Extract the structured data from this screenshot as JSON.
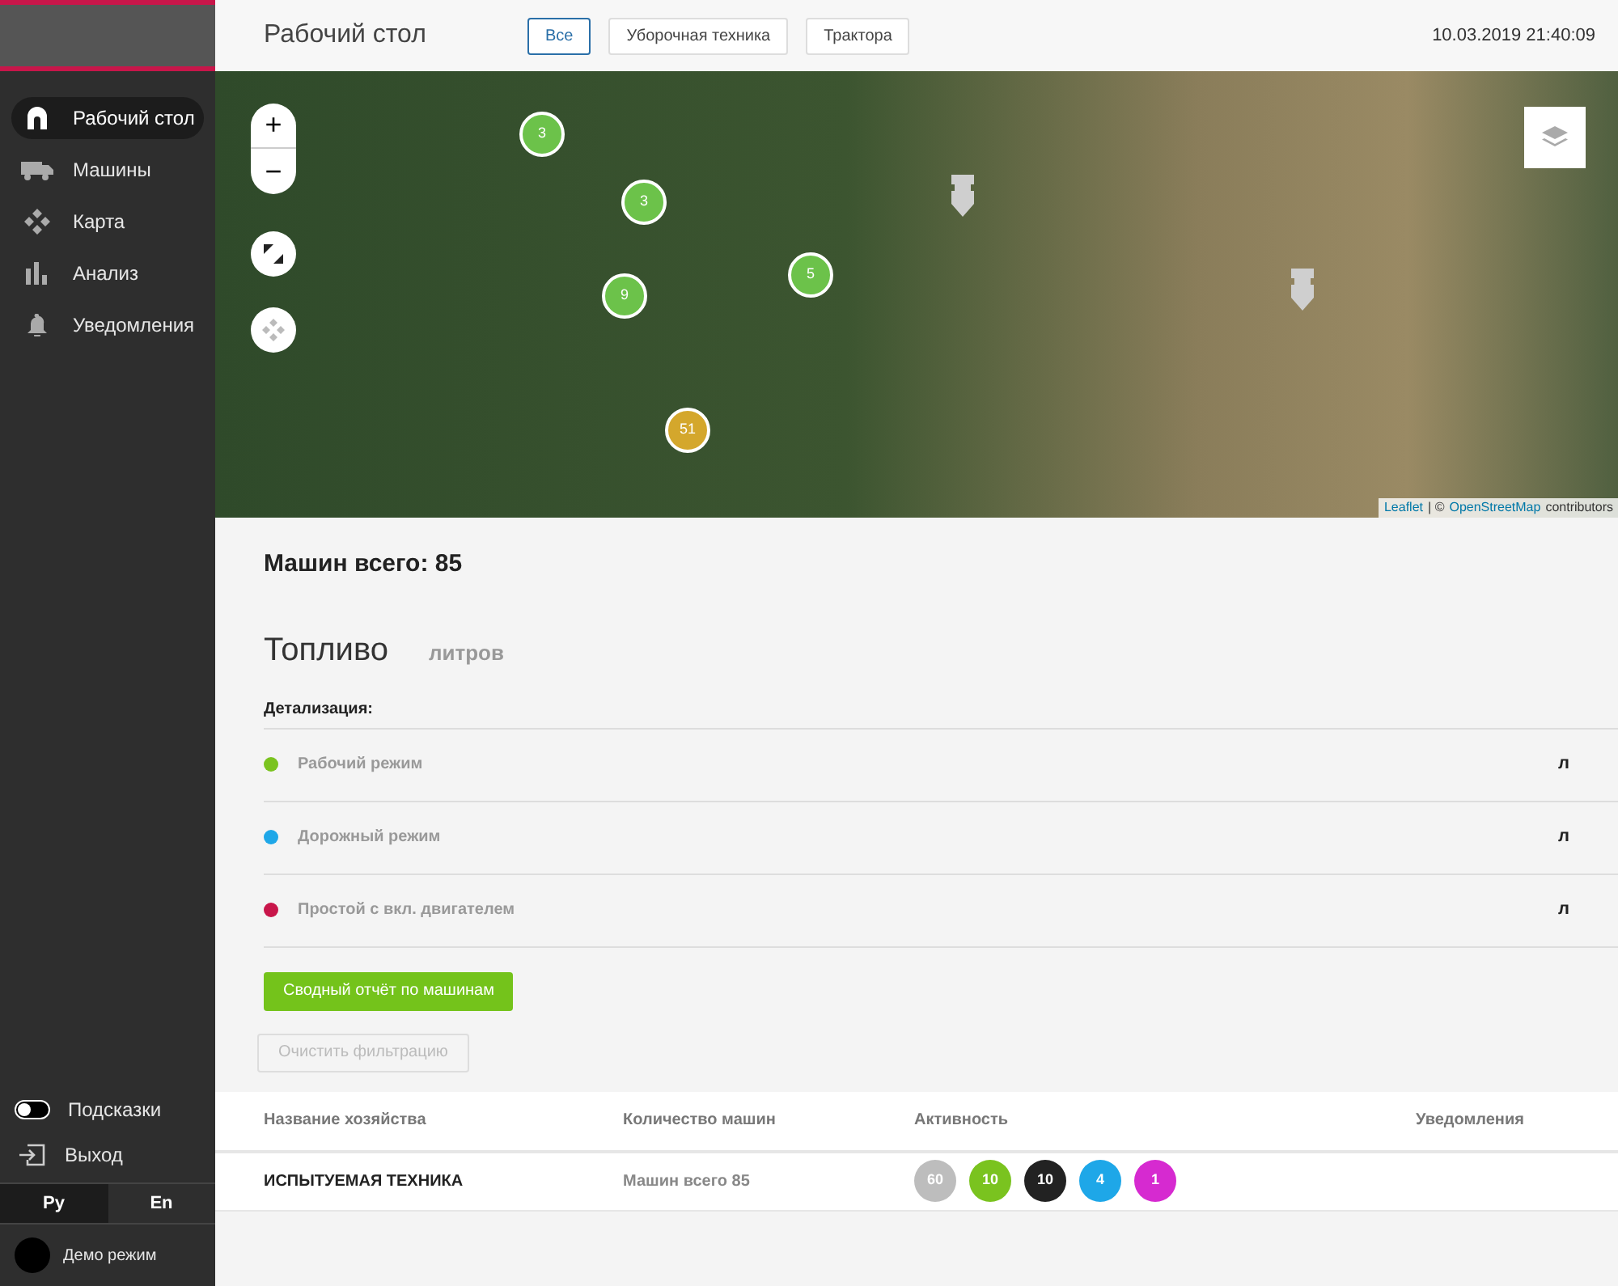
{
  "sidebar": {
    "items": [
      {
        "label": "Рабочий стол",
        "selected": true
      },
      {
        "label": "Машины",
        "selected": false
      },
      {
        "label": "Карта",
        "selected": false
      },
      {
        "label": "Анализ",
        "selected": false
      },
      {
        "label": "Уведомления",
        "selected": false
      }
    ],
    "hints": {
      "label": "Подсказки",
      "on": false
    },
    "logout": {
      "label": "Выход"
    },
    "languages": [
      {
        "label": "Ру",
        "selected": true
      },
      {
        "label": "En",
        "selected": false
      }
    ],
    "user": {
      "label": "Демо режим"
    }
  },
  "header": {
    "title": "Рабочий стол",
    "filters": [
      {
        "label": "Все",
        "selected": true
      },
      {
        "label": "Уборочная техника",
        "selected": false
      },
      {
        "label": "Трактора",
        "selected": false
      }
    ],
    "datetime": "10.03.2019 21:40:09"
  },
  "map": {
    "zoom_in": "+",
    "zoom_out": "−",
    "clusters": [
      {
        "count": "3",
        "color": "#6cc24a"
      },
      {
        "count": "3",
        "color": "#6cc24a"
      },
      {
        "count": "9",
        "color": "#6cc24a"
      },
      {
        "count": "5",
        "color": "#6cc24a"
      },
      {
        "count": "51",
        "color": "#d4a72c"
      }
    ],
    "attribution": {
      "link": "Leaflet",
      "separator": "| ©",
      "source": "OpenStreetMap",
      "suffix": "contributors"
    }
  },
  "summary": {
    "title": "Машин всего: 85"
  },
  "fuel": {
    "title": "Топливо",
    "unit": "литров",
    "detail_label": "Детализация:",
    "rows": [
      {
        "label": "Рабочий режим",
        "color": "#7ac31f",
        "value": "л"
      },
      {
        "label": "Дорожный режим",
        "color": "#1ea7e8",
        "value": "л"
      },
      {
        "label": "Простой с вкл. двигателем",
        "color": "#c8164a",
        "value": "л"
      }
    ]
  },
  "buttons": {
    "report": "Сводный отчёт по машинам",
    "clear": {
      "label": "Очистить фильтрацию",
      "disabled": true
    }
  },
  "table": {
    "columns": [
      "Название хозяйства",
      "Количество машин",
      "Активность",
      "Уведомления"
    ],
    "rows": [
      {
        "name": "ИСПЫТУЕМАЯ ТЕХНИКА",
        "count": "Машин всего 85",
        "activity": [
          {
            "value": "60",
            "color": "#bdbdbd"
          },
          {
            "value": "10",
            "color": "#7ac31f"
          },
          {
            "value": "10",
            "color": "#222222"
          },
          {
            "value": "4",
            "color": "#1ea7e8"
          },
          {
            "value": "1",
            "color": "#d62ad0"
          }
        ]
      }
    ]
  }
}
